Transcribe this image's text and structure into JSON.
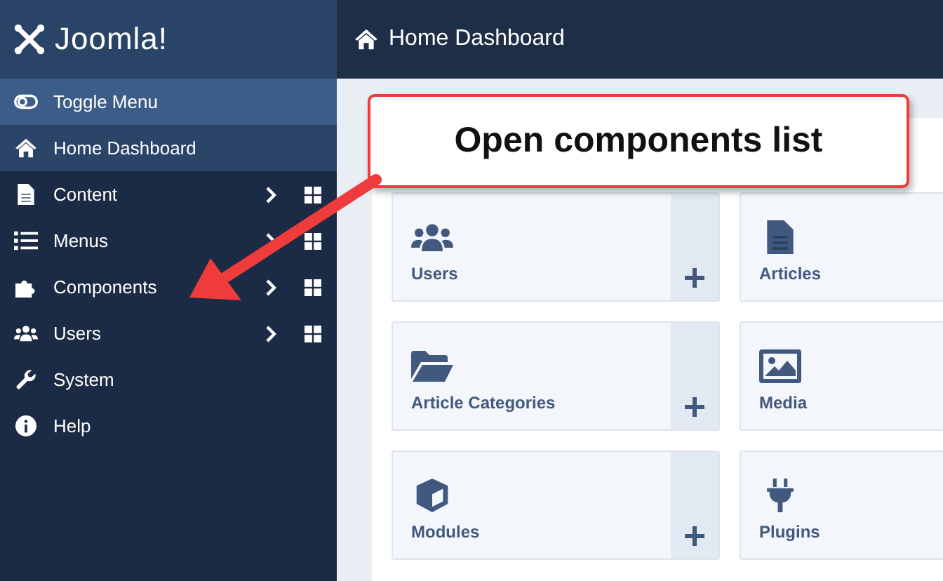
{
  "logo": {
    "text": "Joomla!"
  },
  "sidebar": {
    "items": [
      {
        "label": "Toggle Menu",
        "kind": "toggle",
        "selected": false,
        "submenu": false
      },
      {
        "label": "Home Dashboard",
        "kind": "link",
        "selected": true,
        "submenu": false
      },
      {
        "label": "Content",
        "kind": "link",
        "selected": false,
        "submenu": true
      },
      {
        "label": "Menus",
        "kind": "link",
        "selected": false,
        "submenu": true
      },
      {
        "label": "Components",
        "kind": "link",
        "selected": false,
        "submenu": true
      },
      {
        "label": "Users",
        "kind": "link",
        "selected": false,
        "submenu": true
      },
      {
        "label": "System",
        "kind": "link",
        "selected": false,
        "submenu": false
      },
      {
        "label": "Help",
        "kind": "link",
        "selected": false,
        "submenu": false
      }
    ]
  },
  "header": {
    "title": "Home Dashboard"
  },
  "cards": [
    {
      "label": "Users",
      "add_button": true
    },
    {
      "label": "Articles"
    },
    {
      "label": "Article Categories",
      "add_button": true
    },
    {
      "label": "Media"
    },
    {
      "label": "Modules",
      "add_button": true
    },
    {
      "label": "Plugins"
    }
  ],
  "callout": {
    "text": "Open components list"
  }
}
